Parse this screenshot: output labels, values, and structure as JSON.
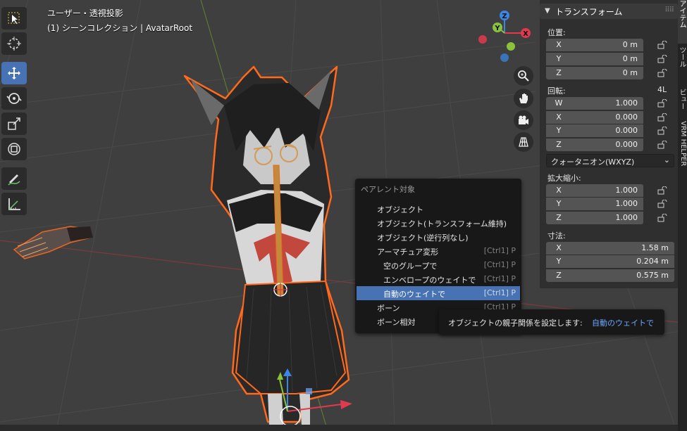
{
  "viewport": {
    "view_name": "ユーザー・透視投影",
    "collection": "(1) シーンコレクション | AvatarRoot"
  },
  "toolbar": {
    "tools": [
      "select-box",
      "cursor",
      "move",
      "rotate",
      "scale",
      "transform",
      "annotate",
      "measure"
    ],
    "active_tool": "move"
  },
  "gizmo": {
    "axes": [
      "X",
      "Y",
      "Z"
    ],
    "colors": {
      "x": "#e2394f",
      "y": "#8bc23b",
      "z": "#3b86e2"
    }
  },
  "nav_buttons": [
    "zoom-icon",
    "hand-icon",
    "camera-icon",
    "grid-icon"
  ],
  "transform_panel": {
    "title": "トランスフォーム",
    "location_label": "位置:",
    "location": [
      {
        "axis": "X",
        "value": "0 m"
      },
      {
        "axis": "Y",
        "value": "0 m"
      },
      {
        "axis": "Z",
        "value": "0 m"
      }
    ],
    "rotation_label": "回転:",
    "rotation_mode_short": "4L",
    "rotation": [
      {
        "axis": "W",
        "value": "1.000"
      },
      {
        "axis": "X",
        "value": "0.000"
      },
      {
        "axis": "Y",
        "value": "0.000"
      },
      {
        "axis": "Z",
        "value": "0.000"
      }
    ],
    "rotation_mode": "クォータニオン(WXYZ)",
    "scale_label": "拡大縮小:",
    "scale": [
      {
        "axis": "X",
        "value": "1.000"
      },
      {
        "axis": "Y",
        "value": "1.000"
      },
      {
        "axis": "Z",
        "value": "1.000"
      }
    ],
    "dimensions_label": "寸法:",
    "dimensions": [
      {
        "axis": "X",
        "value": "1.58 m"
      },
      {
        "axis": "Y",
        "value": "0.204 m"
      },
      {
        "axis": "Z",
        "value": "0.575 m"
      }
    ]
  },
  "side_tabs": [
    "アイテム",
    "ツール",
    "ビュー",
    "VRM HELPER"
  ],
  "context_menu": {
    "title": "ペアレント対象",
    "items": [
      {
        "label": "オブジェクト",
        "shortcut": "",
        "indent": false,
        "highlight": false
      },
      {
        "label": "オブジェクト(トランスフォーム維持)",
        "shortcut": "",
        "indent": false,
        "highlight": false
      },
      {
        "label": "オブジェクト(逆行列なし)",
        "shortcut": "",
        "indent": false,
        "highlight": false
      },
      {
        "label": "アーマチュア変形",
        "shortcut": "[Ctrl1] P",
        "indent": false,
        "highlight": false
      },
      {
        "label": "空のグループで",
        "shortcut": "[Ctrl1] P",
        "indent": true,
        "highlight": false
      },
      {
        "label": "エンベロープのウェイトで",
        "shortcut": "[Ctrl1] P",
        "indent": true,
        "highlight": false
      },
      {
        "label": "自動のウェイトで",
        "shortcut": "[Ctrl1] P",
        "indent": true,
        "highlight": true
      },
      {
        "label": "ボーン",
        "shortcut": "[Ctrl1] P",
        "indent": false,
        "highlight": false
      },
      {
        "label": "ボーン相対",
        "shortcut": "",
        "indent": false,
        "highlight": false
      }
    ]
  },
  "tooltip": {
    "description": "オブジェクトの親子関係を設定します:",
    "value": "自動のウェイトで"
  }
}
